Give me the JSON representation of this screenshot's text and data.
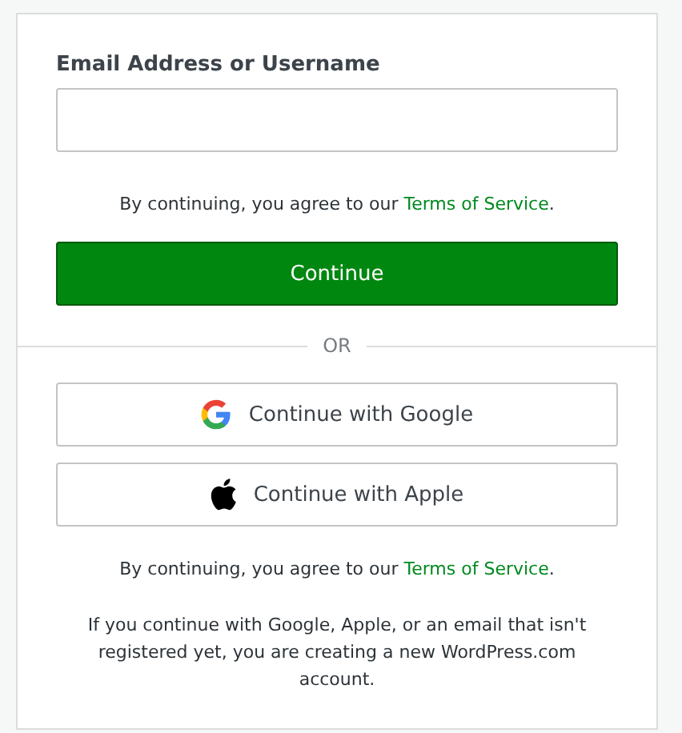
{
  "login_form": {
    "field_label": "Email Address or Username",
    "terms": {
      "before": "By continuing, you agree to our",
      "link": "Terms of Service",
      "after": "."
    },
    "continue_button": "Continue"
  },
  "divider": "OR",
  "social_buttons": [
    {
      "kind": "google",
      "label": "Continue with Google"
    },
    {
      "kind": "apple",
      "label": "Continue with Apple"
    }
  ],
  "social_terms": {
    "before": "By continuing, you agree to our",
    "link": "Terms of Service",
    "after": "."
  },
  "notice": "If you continue with Google, Apple, or an email that isn't registered yet, you are creating a new WordPress.com account."
}
